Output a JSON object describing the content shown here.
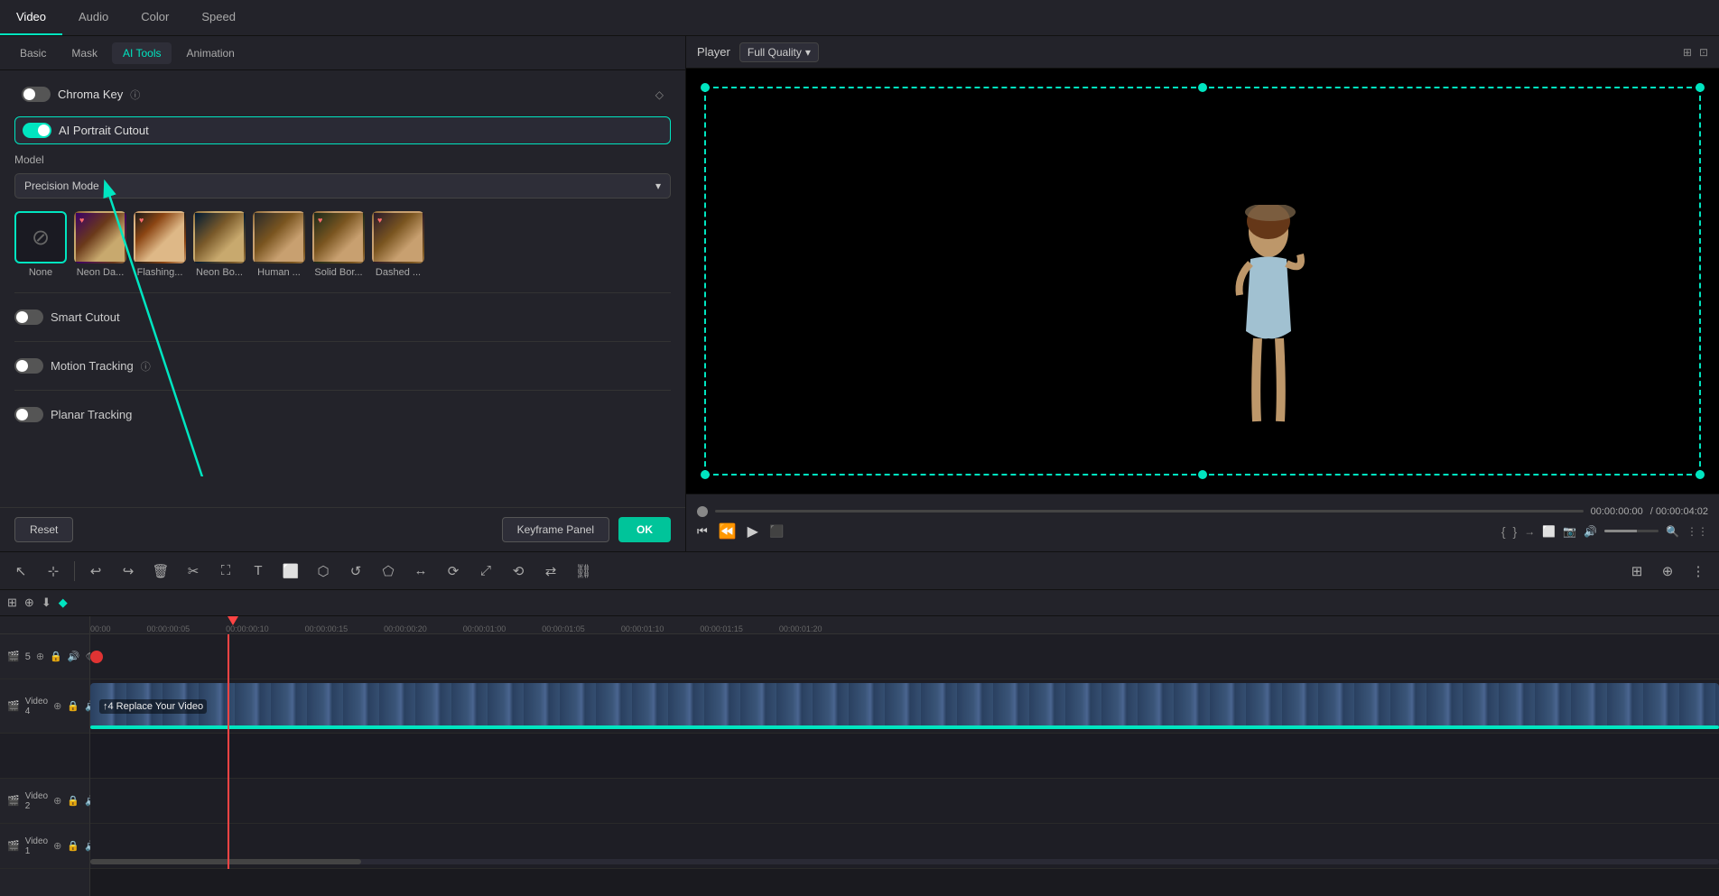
{
  "tabs": {
    "top": [
      "Video",
      "Audio",
      "Color",
      "Speed"
    ],
    "active_top": "Video",
    "sub": [
      "Basic",
      "Mask",
      "AI Tools",
      "Animation"
    ],
    "active_sub": "AI Tools"
  },
  "panel": {
    "chroma_key_label": "Chroma Key",
    "ai_portrait_label": "AI Portrait Cutout",
    "model_label": "Model",
    "model_value": "Precision Mode",
    "effects": [
      {
        "id": "none",
        "label": "None",
        "active": true,
        "heart": false
      },
      {
        "id": "neon_da",
        "label": "Neon Da...",
        "active": false,
        "heart": true
      },
      {
        "id": "flashing",
        "label": "Flashing...",
        "active": false,
        "heart": true
      },
      {
        "id": "neon_bo",
        "label": "Neon Bo...",
        "active": false,
        "heart": false
      },
      {
        "id": "human",
        "label": "Human ...",
        "active": false,
        "heart": false
      },
      {
        "id": "solid_bor",
        "label": "Solid Bor...",
        "active": false,
        "heart": true
      },
      {
        "id": "dashed",
        "label": "Dashed ...",
        "active": false,
        "heart": true
      }
    ],
    "smart_cutout_label": "Smart Cutout",
    "motion_tracking_label": "Motion Tracking",
    "planar_tracking_label": "Planar Tracking",
    "reset_label": "Reset",
    "keyframe_label": "Keyframe Panel",
    "ok_label": "OK"
  },
  "player": {
    "title": "Player",
    "quality": "Full Quality",
    "time_current": "00:00:00:00",
    "time_total": "/ 00:00:04:02"
  },
  "toolbar": {
    "tools": [
      "↩",
      "↩",
      "🗑",
      "✂",
      "⛶",
      "T",
      "⬜",
      "⬡",
      "↺",
      "⬡",
      "↔",
      "⟳",
      "⟲",
      "⤢",
      "⟳",
      "⇄",
      "⛓"
    ]
  },
  "timeline": {
    "ruler_marks": [
      "00:00",
      "00:00:00:05",
      "00:00:00:10",
      "00:00:00:15",
      "00:00:00:20",
      "00:00:01:00",
      "00:00:01:05",
      "00:00:01:10",
      "00:00:01:15",
      "00:00:01:20"
    ],
    "tracks": [
      {
        "label": "5",
        "type": "video",
        "has_clip": false
      },
      {
        "label": "Video 4",
        "type": "video",
        "has_clip": true,
        "clip_label": "↑4 Replace Your Video"
      },
      {
        "label": "",
        "type": "empty",
        "has_clip": false
      },
      {
        "label": "Video 2",
        "type": "video",
        "has_clip": false
      },
      {
        "label": "Video 1",
        "type": "video",
        "has_clip": false
      }
    ]
  }
}
